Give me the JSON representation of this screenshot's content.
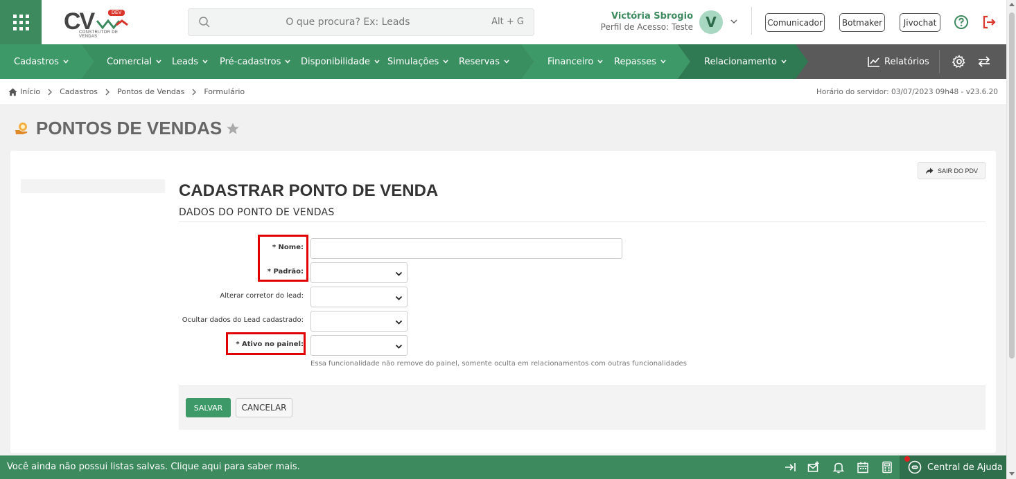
{
  "header": {
    "logo": {
      "text": "CV",
      "badge": "DEV",
      "subtitle": "CONSTRUTOR DE VENDAS"
    },
    "search": {
      "placeholder": "O que procura? Ex: Leads",
      "shortcut": "Alt + G"
    },
    "user": {
      "name": "Victória Sbrogio",
      "profile": "Perfil de Acesso: Teste",
      "initial": "V"
    },
    "buttons": {
      "comunicador": "Comunicador",
      "botmaker": "Botmaker",
      "jivochat": "Jivochat"
    },
    "colors": {
      "brand_green": "#3d8a5f",
      "logout_red": "#d9352b"
    }
  },
  "nav": {
    "items": [
      {
        "label": "Cadastros"
      },
      {
        "label": "Comercial"
      },
      {
        "label": "Leads"
      },
      {
        "label": "Pré-cadastros"
      },
      {
        "label": "Disponibilidade"
      },
      {
        "label": "Simulações"
      },
      {
        "label": "Reservas"
      },
      {
        "label": "Financeiro"
      },
      {
        "label": "Repasses"
      },
      {
        "label": "Relacionamento"
      }
    ],
    "reports": "Relatórios"
  },
  "breadcrumb": {
    "items": [
      "Início",
      "Cadastros",
      "Pontos de Vendas",
      "Formulário"
    ],
    "server_time": "Horário do servidor: 03/07/2023 09h48 - v23.6.20"
  },
  "page": {
    "title": "PONTOS DE VENDAS"
  },
  "form": {
    "exit_button": "SAIR DO PDV",
    "title": "CADASTRAR PONTO DE VENDA",
    "subtitle": "DADOS DO PONTO DE VENDAS",
    "fields": {
      "nome": {
        "label": "* Nome:",
        "value": ""
      },
      "padrao": {
        "label": "* Padrão:",
        "value": ""
      },
      "alterar_corretor": {
        "label": "Alterar corretor do lead:",
        "value": ""
      },
      "ocultar_dados": {
        "label": "Ocultar dados do Lead cadastrado:",
        "value": ""
      },
      "ativo_painel": {
        "label": "* Ativo no painel:",
        "value": ""
      }
    },
    "hint": "Essa funcionalidade não remove do painel, somente oculta em relacionamentos com outras funcionalidades",
    "save": "SALVAR",
    "cancel": "CANCELAR"
  },
  "footer": {
    "message": "Você ainda não possui listas salvas. Clique aqui para saber mais.",
    "help_center": "Central de Ajuda"
  }
}
